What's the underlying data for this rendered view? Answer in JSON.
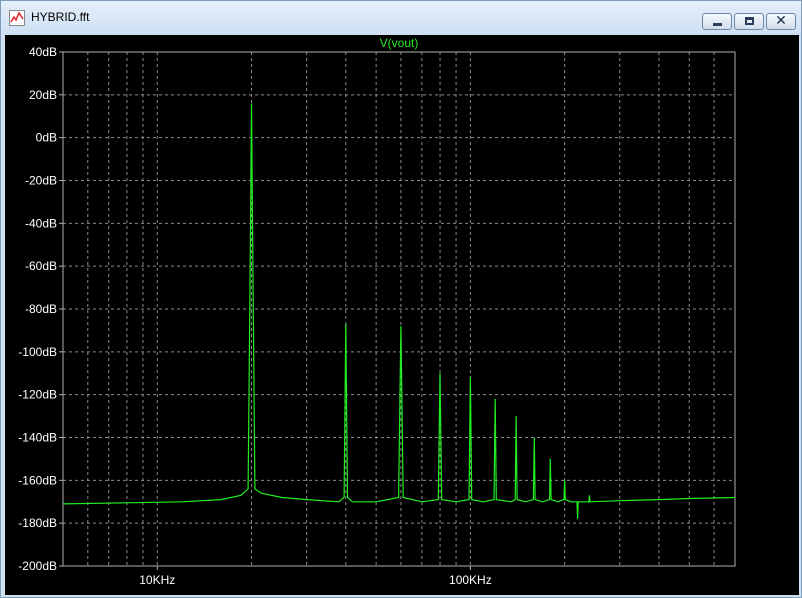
{
  "window": {
    "title": "HYBRID.fft",
    "icon": "waveform-app-icon",
    "buttons": {
      "minimize": "minimize-icon",
      "maximize": "maximize-icon",
      "close": "close-icon"
    },
    "close_glyph": "✕"
  },
  "colors": {
    "background": "#000000",
    "trace": "#22ee22",
    "grid": "#8a8a8a",
    "text": "#ffffff",
    "title": "#22ee22"
  },
  "chart_data": {
    "type": "line",
    "title": "V(vout)",
    "xlabel": "",
    "ylabel": "",
    "x_scale": "log",
    "xlim": [
      5000,
      700000
    ],
    "ylim": [
      -200,
      40
    ],
    "grid": true,
    "y_ticks": [
      "40dB",
      "20dB",
      "0dB",
      "-20dB",
      "-40dB",
      "-60dB",
      "-80dB",
      "-100dB",
      "-120dB",
      "-140dB",
      "-160dB",
      "-180dB",
      "-200dB"
    ],
    "y_tick_values": [
      40,
      20,
      0,
      -20,
      -40,
      -60,
      -80,
      -100,
      -120,
      -140,
      -160,
      -180,
      -200
    ],
    "x_ticks": [
      "10KHz",
      "100KHz"
    ],
    "x_tick_values": [
      10000,
      100000
    ],
    "series": [
      {
        "name": "V(vout)",
        "x": [
          5000,
          8000,
          12000,
          16000,
          18500,
          19500,
          19800,
          20000,
          20200,
          20500,
          21500,
          25000,
          30000,
          38000,
          39500,
          40000,
          40500,
          42000,
          50000,
          59000,
          60000,
          61000,
          70000,
          79000,
          80000,
          81000,
          90000,
          99000,
          100000,
          101000,
          110000,
          119000,
          120000,
          121000,
          135000,
          139000,
          140000,
          141000,
          150000,
          159000,
          160000,
          161000,
          170000,
          179000,
          180000,
          181000,
          190000,
          199000,
          200000,
          201000,
          210000,
          219000,
          220000,
          221000,
          230000,
          239000,
          240000,
          241000,
          300000,
          400000,
          500000,
          700000
        ],
        "y": [
          -171,
          -170.5,
          -170,
          -169,
          -167,
          -164,
          -60,
          16,
          -60,
          -164,
          -166,
          -168,
          -169,
          -170,
          -168,
          -87,
          -168,
          -170,
          -170,
          -168,
          -88,
          -168,
          -170,
          -169,
          -110,
          -169,
          -170,
          -169,
          -112,
          -169,
          -170,
          -169,
          -122,
          -169,
          -170,
          -169,
          -130,
          -169,
          -170,
          -169,
          -140,
          -169,
          -170,
          -169,
          -150,
          -169,
          -170,
          -169,
          -160,
          -169,
          -170,
          -170,
          -178,
          -170,
          -170,
          -170,
          -167,
          -170,
          -169.5,
          -169,
          -168.5,
          -168
        ]
      }
    ]
  }
}
